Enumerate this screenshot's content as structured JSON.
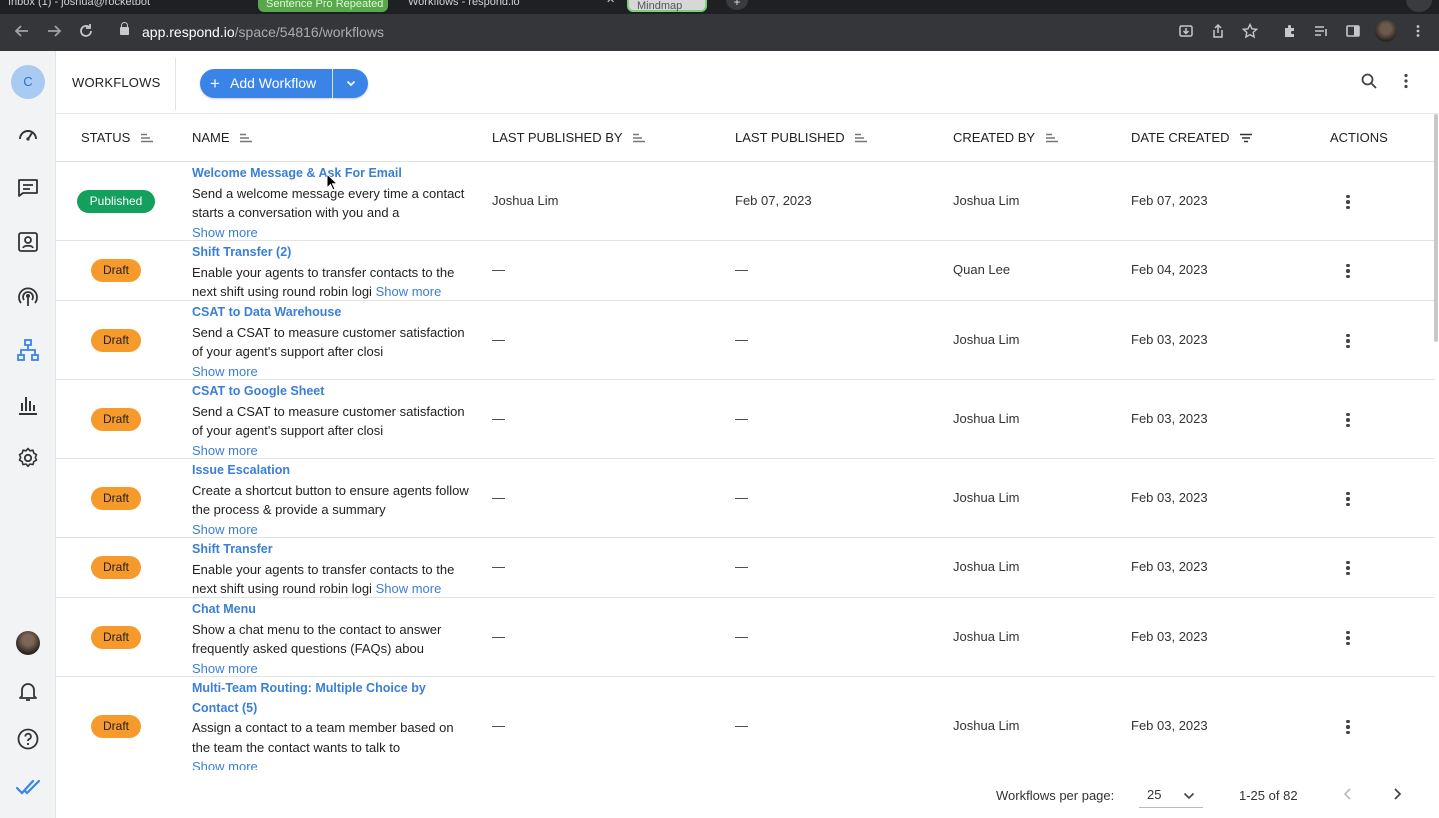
{
  "browser": {
    "tabs": [
      {
        "label": "Inbox (1) - joshua@rocketbot",
        "style": "normal"
      },
      {
        "label": "Sentence Pro Repeated",
        "style": "green"
      },
      {
        "label": "Workflows - respond.io",
        "style": "active"
      },
      {
        "label": "Mindmap",
        "style": "mm"
      }
    ],
    "url_host": "app.respond.io",
    "url_path": "/space/54816/workflows",
    "icons": [
      "back-icon",
      "forward-icon",
      "reload-icon",
      "lock-icon",
      "install-icon",
      "share-icon",
      "star-icon",
      "extensions-icon",
      "reading-list-icon",
      "side-panel-icon",
      "profile-avatar",
      "kebab-menu-icon"
    ]
  },
  "sidebar": {
    "space_initial": "C",
    "items": [
      {
        "name": "dashboard",
        "icon": "speedometer-icon"
      },
      {
        "name": "inbox",
        "icon": "message-icon"
      },
      {
        "name": "contacts",
        "icon": "contact-card-icon"
      },
      {
        "name": "broadcasts",
        "icon": "broadcast-icon"
      },
      {
        "name": "workflows",
        "icon": "workflow-icon",
        "active": true
      },
      {
        "name": "reports",
        "icon": "bar-chart-icon"
      },
      {
        "name": "settings",
        "icon": "gear-icon"
      }
    ],
    "bottom": [
      "avatar",
      "bell-icon",
      "help-icon",
      "double-check-logo-icon"
    ]
  },
  "header": {
    "title": "WORKFLOWS",
    "add_label": "Add Workflow",
    "accent": "#3a84e8"
  },
  "table": {
    "columns": [
      {
        "label": "STATUS",
        "sort": "neutral"
      },
      {
        "label": "NAME",
        "sort": "neutral"
      },
      {
        "label": "LAST PUBLISHED BY",
        "sort": "neutral"
      },
      {
        "label": "LAST PUBLISHED",
        "sort": "neutral"
      },
      {
        "label": "CREATED BY",
        "sort": "neutral"
      },
      {
        "label": "DATE CREATED",
        "sort": "desc"
      },
      {
        "label": "ACTIONS",
        "sort": "none"
      }
    ],
    "rows": [
      {
        "status": "Published",
        "title": "Welcome Message & Ask For Email",
        "desc": "Send a welcome message every time a contact starts a conversation with you and a",
        "more": "Show more",
        "inline_more": false,
        "last_published_by": "Joshua Lim",
        "last_published": "Feb 07, 2023",
        "created_by": "Joshua Lim",
        "date_created": "Feb 07, 2023"
      },
      {
        "status": "Draft",
        "title": "Shift Transfer (2)",
        "desc": "Enable your agents to transfer contacts to the next shift using round robin logi",
        "more": "Show more",
        "inline_more": true,
        "last_published_by": "—",
        "last_published": "—",
        "created_by": "Quan Lee",
        "date_created": "Feb 04, 2023"
      },
      {
        "status": "Draft",
        "title": "CSAT to Data Warehouse",
        "desc": "Send a CSAT to measure customer satisfaction of your agent's support after closi",
        "more": "Show more",
        "inline_more": false,
        "last_published_by": "—",
        "last_published": "—",
        "created_by": "Joshua Lim",
        "date_created": "Feb 03, 2023"
      },
      {
        "status": "Draft",
        "title": "CSAT to Google Sheet",
        "desc": "Send a CSAT to measure customer satisfaction of your agent's support after closi",
        "more": "Show more",
        "inline_more": false,
        "last_published_by": "—",
        "last_published": "—",
        "created_by": "Joshua Lim",
        "date_created": "Feb 03, 2023"
      },
      {
        "status": "Draft",
        "title": "Issue Escalation",
        "desc": "Create a shortcut button to ensure agents follow the process & provide a summary",
        "more": "Show more",
        "inline_more": false,
        "last_published_by": "—",
        "last_published": "—",
        "created_by": "Joshua Lim",
        "date_created": "Feb 03, 2023"
      },
      {
        "status": "Draft",
        "title": "Shift Transfer",
        "desc": "Enable your agents to transfer contacts to the next shift using round robin logi",
        "more": "Show more",
        "inline_more": true,
        "last_published_by": "—",
        "last_published": "—",
        "created_by": "Joshua Lim",
        "date_created": "Feb 03, 2023"
      },
      {
        "status": "Draft",
        "title": "Chat Menu",
        "desc": "Show a chat menu to the contact to answer frequently asked questions (FAQs) abou",
        "more": "Show more",
        "inline_more": false,
        "last_published_by": "—",
        "last_published": "—",
        "created_by": "Joshua Lim",
        "date_created": "Feb 03, 2023"
      },
      {
        "status": "Draft",
        "title": "Multi-Team Routing: Multiple Choice by Contact (5)",
        "desc": "Assign a contact to a team member based on the team the contact wants to talk to",
        "more": "Show more",
        "inline_more": false,
        "last_published_by": "—",
        "last_published": "—",
        "created_by": "Joshua Lim",
        "date_created": "Feb 03, 2023"
      }
    ],
    "status_colors": {
      "Published": "#13a05c",
      "Draft": "#f79a2c"
    }
  },
  "footer": {
    "per_page_label": "Workflows per page:",
    "per_page_value": "25",
    "range": "1-25 of 82"
  }
}
